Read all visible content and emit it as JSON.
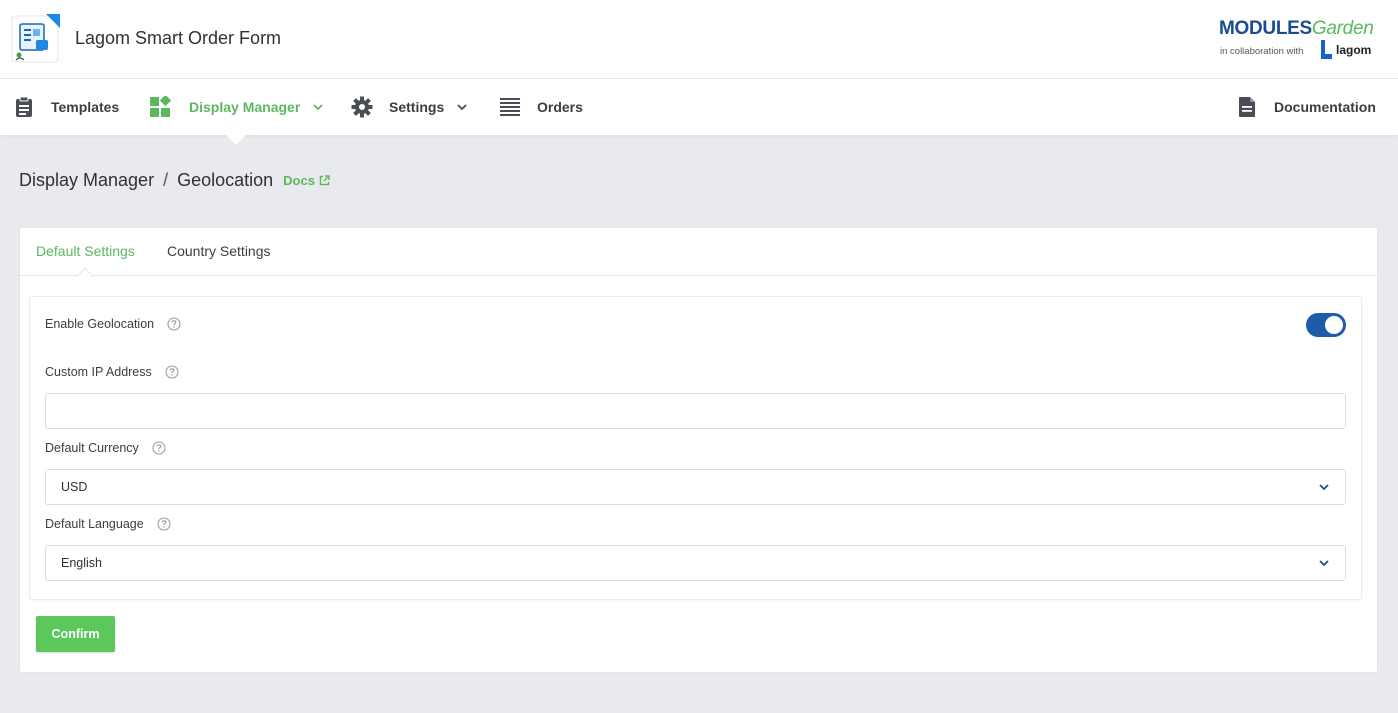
{
  "app": {
    "title": "Lagom Smart Order Form",
    "icon": "order-form-app-icon"
  },
  "brand": {
    "modules": "MODULES",
    "garden": "Garden",
    "collab": "in collaboration with",
    "partner": "lagom"
  },
  "nav": {
    "items": [
      {
        "label": "Templates",
        "icon": "clipboard-icon"
      },
      {
        "label": "Display Manager",
        "icon": "widgets-icon",
        "active": true,
        "dropdown": true
      },
      {
        "label": "Settings",
        "icon": "gear-icon",
        "dropdown": true
      },
      {
        "label": "Orders",
        "icon": "list-icon"
      }
    ],
    "documentation": {
      "label": "Documentation",
      "icon": "document-icon"
    }
  },
  "breadcrumb": {
    "parent": "Display Manager",
    "separator": "/",
    "current": "Geolocation",
    "docs": "Docs"
  },
  "tabs": [
    {
      "label": "Default Settings",
      "active": true
    },
    {
      "label": "Country Settings",
      "active": false
    }
  ],
  "form": {
    "enable_geolocation": {
      "label": "Enable Geolocation",
      "value": true
    },
    "custom_ip": {
      "label": "Custom IP Address",
      "value": "",
      "placeholder": ""
    },
    "default_currency": {
      "label": "Default Currency",
      "value": "USD"
    },
    "default_language": {
      "label": "Default Language",
      "value": "English"
    },
    "confirm": "Confirm"
  },
  "colors": {
    "accent_green": "#5cb85c",
    "toggle_blue": "#1f5ca8",
    "background": "#e9eaee"
  }
}
